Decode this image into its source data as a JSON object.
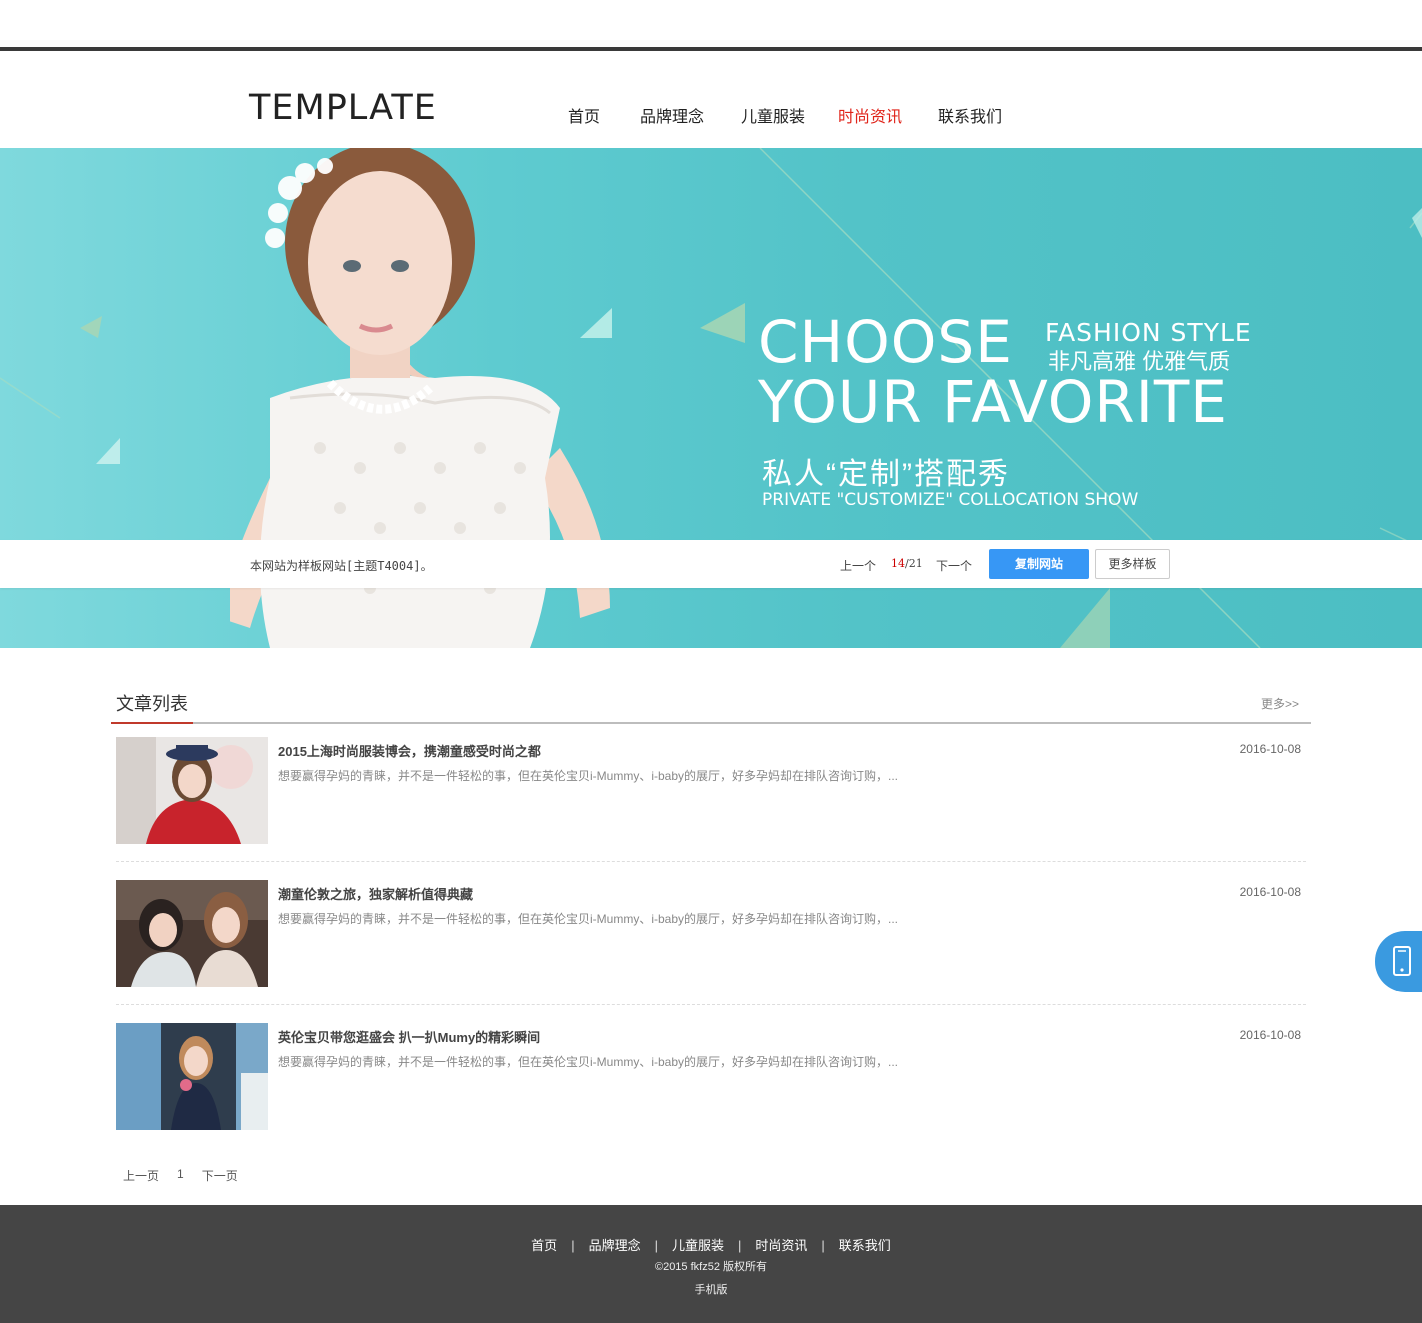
{
  "header": {
    "logo": "TEMPLATE",
    "nav": [
      {
        "label": "首页",
        "active": false
      },
      {
        "label": "品牌理念",
        "active": false
      },
      {
        "label": "儿童服装",
        "active": false
      },
      {
        "label": "时尚资讯",
        "active": true
      },
      {
        "label": "联系我们",
        "active": false
      }
    ]
  },
  "banner": {
    "line1": "CHOOSE",
    "line2": "YOUR FAVORITE",
    "fashion_style": "FASHION STYLE",
    "cn_tagline": "非凡高雅 优雅气质",
    "cn_title": "私人“定制”搭配秀",
    "en_title": "PRIVATE \"CUSTOMIZE\" COLLOCATION SHOW",
    "accent_color": "#53c3c8"
  },
  "strip": {
    "note": "本网站为样板网站[主题T4004]。",
    "prev": "上一个",
    "current": "14",
    "total": "/21",
    "next": "下一个",
    "copy_label": "复制网站",
    "more_label": "更多样板"
  },
  "section": {
    "title": "文章列表",
    "more": "更多>>"
  },
  "articles": [
    {
      "title": "2015上海时尚服装博会，携潮童感受时尚之都",
      "desc": "想要赢得孕妈的青睐，并不是一件轻松的事，但在英伦宝贝i-Mummy、i-baby的展厅，好多孕妈却在排队咨询订购，...",
      "date": "2016-10-08"
    },
    {
      "title": "潮童伦敦之旅，独家解析值得典藏",
      "desc": "想要赢得孕妈的青睐，并不是一件轻松的事，但在英伦宝贝i-Mummy、i-baby的展厅，好多孕妈却在排队咨询订购，...",
      "date": "2016-10-08"
    },
    {
      "title": "英伦宝贝带您逛盛会 扒一扒Mumy的精彩瞬间",
      "desc": "想要赢得孕妈的青睐，并不是一件轻松的事，但在英伦宝贝i-Mummy、i-baby的展厅，好多孕妈却在排队咨询订购，...",
      "date": "2016-10-08"
    }
  ],
  "pager": {
    "prev": "上一页",
    "page": "1",
    "next": "下一页"
  },
  "footer": {
    "nav": [
      "首页",
      "品牌理念",
      "儿童服装",
      "时尚资讯",
      "联系我们"
    ],
    "separator": "|",
    "copyright": "©2015 fkfz52 版权所有",
    "mobile": "手机版"
  },
  "icons": {
    "phone": "mobile-phone-icon"
  }
}
